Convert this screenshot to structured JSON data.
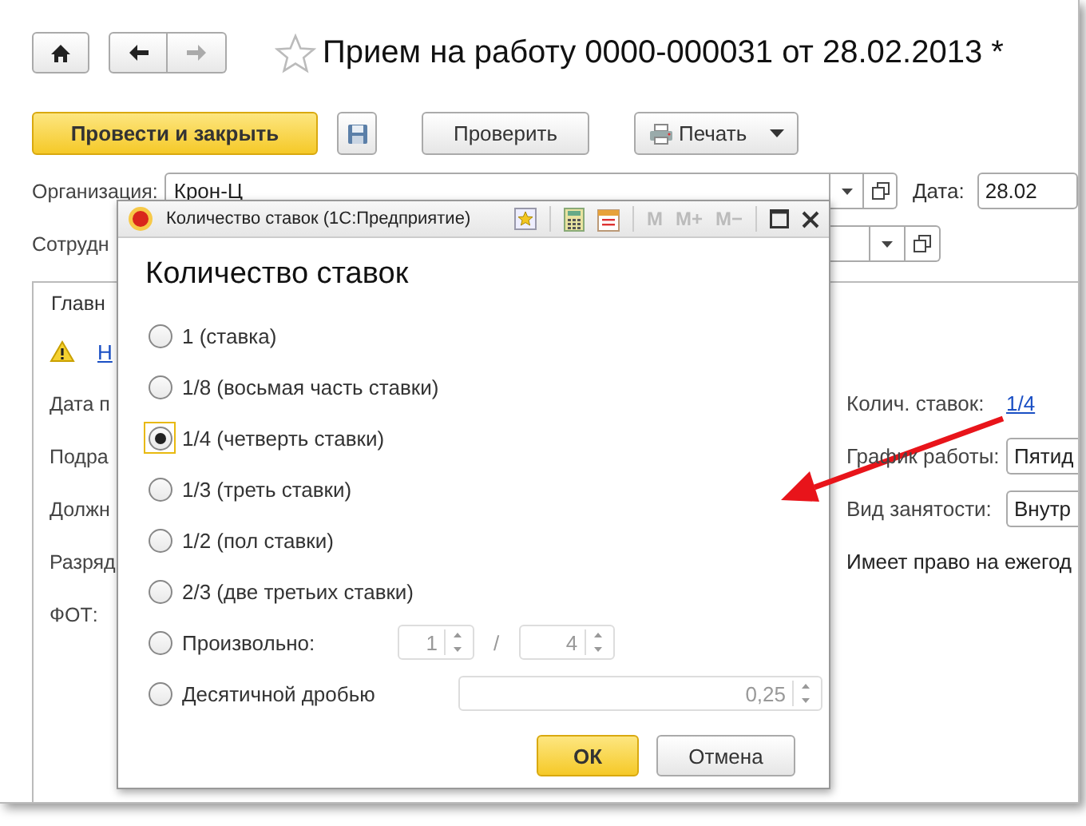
{
  "window": {
    "title": "Прием на работу 0000-000031 от 28.02.2013 *",
    "favorite": false
  },
  "navigation": {
    "back_enabled": true,
    "forward_enabled": false
  },
  "toolbar": [
    {
      "kind": "primary",
      "label": "Провести и закрыть"
    },
    {
      "kind": "save"
    },
    {
      "kind": "plain",
      "label": "Проверить"
    },
    {
      "kind": "menu",
      "label": "Печать"
    }
  ],
  "header_fields": [
    {
      "label": "Организация:",
      "value": "Крон-Ц"
    },
    {
      "label": "Сотрудн"
    }
  ],
  "date": {
    "label": "Дата:",
    "value": "28.02"
  },
  "tab": {
    "label": "Главн"
  },
  "warning_link": "Н",
  "left_labels": [
    "Дата п",
    "Подра",
    "Должн",
    "Разряд",
    "ФОТ:"
  ],
  "right_fields": [
    {
      "kind": "link",
      "label": "Колич. ставок:",
      "value": "1/4"
    },
    {
      "kind": "select",
      "label": "График работы:",
      "value": "Пятид"
    },
    {
      "kind": "select",
      "label": "Вид занятости:",
      "value": "Внутр"
    },
    {
      "kind": "text",
      "label": "Имеет право на ежегод"
    }
  ],
  "dialog": {
    "title": "Количество ставок  (1С:Предприятие)",
    "memory_buttons": [
      {
        "label": "M",
        "disabled": true
      },
      {
        "label": "M+",
        "disabled": true
      },
      {
        "label": "M−",
        "disabled": true
      }
    ],
    "heading": "Количество ставок",
    "options": [
      {
        "kind": "plain",
        "label": "1 (ставка)",
        "selected": false,
        "focused": false
      },
      {
        "kind": "plain",
        "label": "1/8 (восьмая часть ставки)",
        "selected": false,
        "focused": false
      },
      {
        "kind": "plain",
        "label": "1/4 (четверть ставки)",
        "selected": true,
        "focused": true
      },
      {
        "kind": "plain",
        "label": "1/3 (треть ставки)",
        "selected": false,
        "focused": false
      },
      {
        "kind": "plain",
        "label": "1/2 (пол ставки)",
        "selected": false,
        "focused": false
      },
      {
        "kind": "plain",
        "label": "2/3 (две третьих ставки)",
        "selected": false,
        "focused": false
      },
      {
        "kind": "fraction",
        "label": "Произвольно:",
        "selected": false,
        "focused": false,
        "numerator": "1",
        "separator": "/",
        "denominator": "4",
        "disabled": true
      },
      {
        "kind": "decimal",
        "label": "Десятичной дробью",
        "selected": false,
        "focused": false,
        "value": "0,25",
        "disabled": true
      }
    ],
    "buttons": [
      {
        "kind": "default",
        "label": "ОК"
      },
      {
        "kind": "plain",
        "label": "Отмена"
      }
    ]
  }
}
